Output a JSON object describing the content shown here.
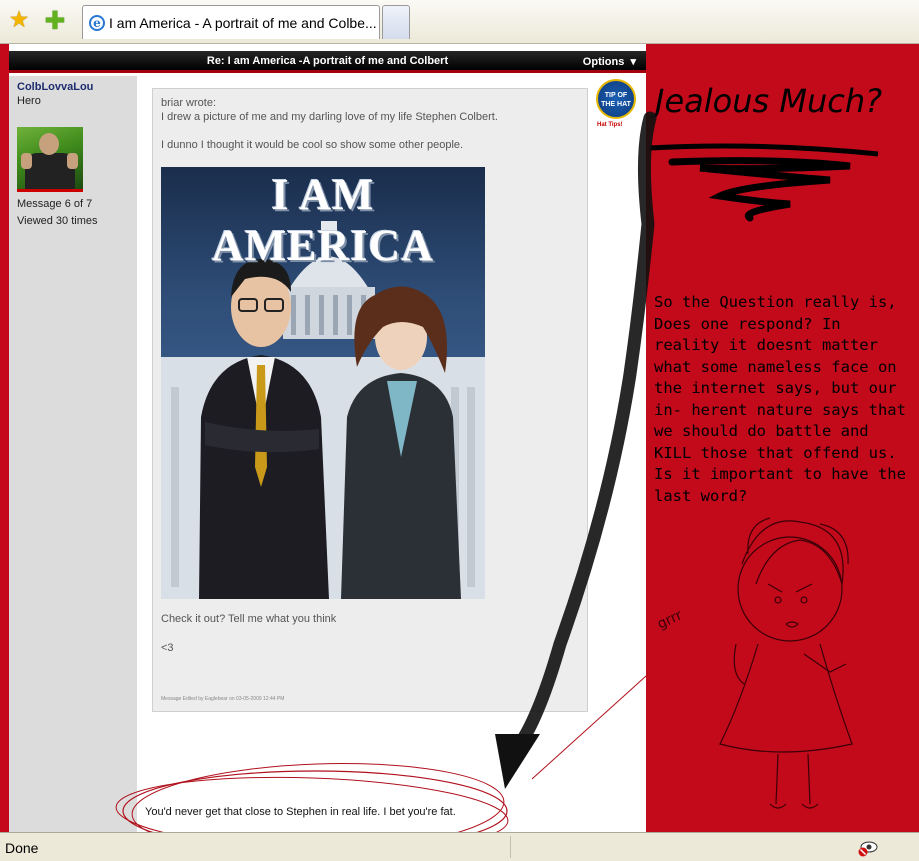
{
  "browser": {
    "tab_title": "I am America - A portrait of me and Colbe...",
    "status_text": "Done",
    "icons": [
      "favorites-star-icon",
      "add-favorite-icon",
      "ie-logo-icon",
      "privacy-report-icon"
    ]
  },
  "post": {
    "header_title": "Re: I am America -A portrait of me and Colbert",
    "options_label": "Options",
    "author": {
      "name": "ColbLovvaLou",
      "rank": "Hero",
      "message_count": "Message 6 of 7",
      "views": "Viewed 30 times"
    },
    "quote": {
      "author_line": "briar wrote:",
      "line1": "I drew a picture of me and my darling love of my life Stephen Colbert.",
      "line2": "I dunno I thought it would be cool so show some other people.",
      "artwork_title": "I AM AMERICA",
      "line3": "Check it out? Tell me what you think",
      "heart": "<3",
      "edited_note": "Message Edited by Eaglebear on 03-05-2009 12:44 PM"
    },
    "hat_tips_label": "Hat Tips!",
    "hat_badge": "TIP OF THE HAT",
    "reply": "You'd never get that close to Stephen in real life.  I bet you're fat."
  },
  "annotation": {
    "heading": "Jealous Much?",
    "body": "So the Question really is, Does one respond? In reality it doesnt matter what some nameless face on the internet says, but our in- herent nature says that we should do battle and KILL those that offend us. Is it important to have the last word?",
    "growl": "grrr"
  },
  "colors": {
    "panel_red": "#c20a1b",
    "header_black": "#000000",
    "username_blue": "#1c2c6e",
    "circle_red": "#b0101c"
  }
}
